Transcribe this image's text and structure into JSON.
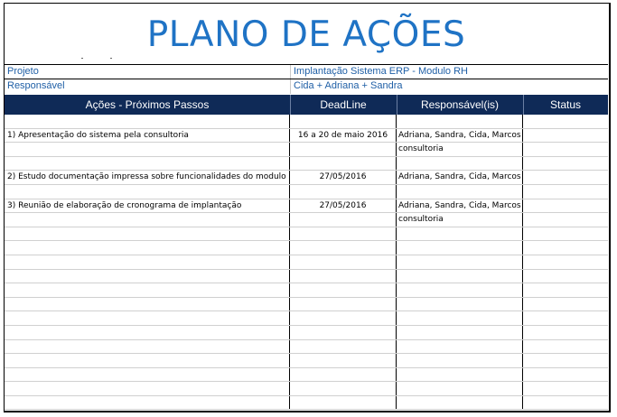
{
  "title": "PLANO DE AÇÕES",
  "meta": [
    {
      "label": "Projeto",
      "value": "Implantação Sistema ERP - Modulo RH"
    },
    {
      "label": "Responsável",
      "value": "Cida + Adriana + Sandra"
    }
  ],
  "columns": [
    "Ações - Próximos Passos",
    "DeadLine",
    "Responsável(is)",
    "Status"
  ],
  "rows": [
    [
      "",
      "",
      "",
      ""
    ],
    [
      "1) Apresentação do sistema pela consultoria",
      "16 a 20 de maio 2016",
      "Adriana, Sandra, Cida, Marcos",
      ""
    ],
    [
      "",
      "",
      "consultoria",
      ""
    ],
    [
      "",
      "",
      "",
      ""
    ],
    [
      "2) Estudo documentação impressa sobre funcionalidades do modulo",
      "27/05/2016",
      "Adriana, Sandra, Cida, Marcos",
      ""
    ],
    [
      "",
      "",
      "",
      ""
    ],
    [
      "3) Reunião de elaboração de cronograma de implantação",
      "27/05/2016",
      "Adriana, Sandra, Cida, Marcos",
      ""
    ],
    [
      "",
      "",
      "consultoria",
      ""
    ],
    [
      "",
      "",
      "",
      ""
    ],
    [
      "",
      "",
      "",
      ""
    ],
    [
      "",
      "",
      "",
      ""
    ],
    [
      "",
      "",
      "",
      ""
    ],
    [
      "",
      "",
      "",
      ""
    ],
    [
      "",
      "",
      "",
      ""
    ],
    [
      "",
      "",
      "",
      ""
    ],
    [
      "",
      "",
      "",
      ""
    ],
    [
      "",
      "",
      "",
      ""
    ],
    [
      "",
      "",
      "",
      ""
    ],
    [
      "",
      "",
      "",
      ""
    ],
    [
      "",
      "",
      "",
      ""
    ],
    [
      "",
      "",
      "",
      ""
    ]
  ]
}
